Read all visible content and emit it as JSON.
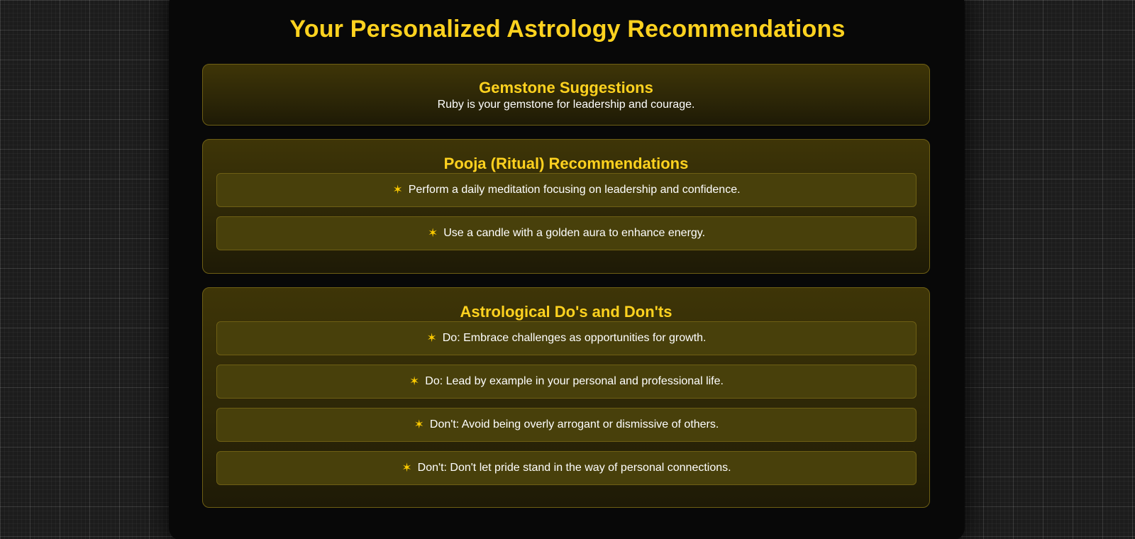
{
  "page": {
    "title": "Your Personalized Astrology Recommendations"
  },
  "gemstone": {
    "title": "Gemstone Suggestions",
    "text": "Ruby is your gemstone for leadership and courage."
  },
  "pooja": {
    "title": "Pooja (Ritual) Recommendations",
    "items": [
      "Perform a daily meditation focusing on leadership and confidence.",
      "Use a candle with a golden aura to enhance energy."
    ]
  },
  "dos_donts": {
    "title": "Astrological Do's and Don'ts",
    "items": [
      "Do: Embrace challenges as opportunities for growth.",
      "Do: Lead by example in your personal and professional life.",
      "Don't: Avoid being overly arrogant or dismissive of others.",
      "Don't: Don't let pride stand in the way of personal connections."
    ]
  },
  "icons": {
    "bullet": "star-icon",
    "bullet_glyph": "✶"
  },
  "colors": {
    "accent": "#ffd21f",
    "text": "#ffffff",
    "card_bg": "#3e3507",
    "border": "#6e5f14"
  }
}
